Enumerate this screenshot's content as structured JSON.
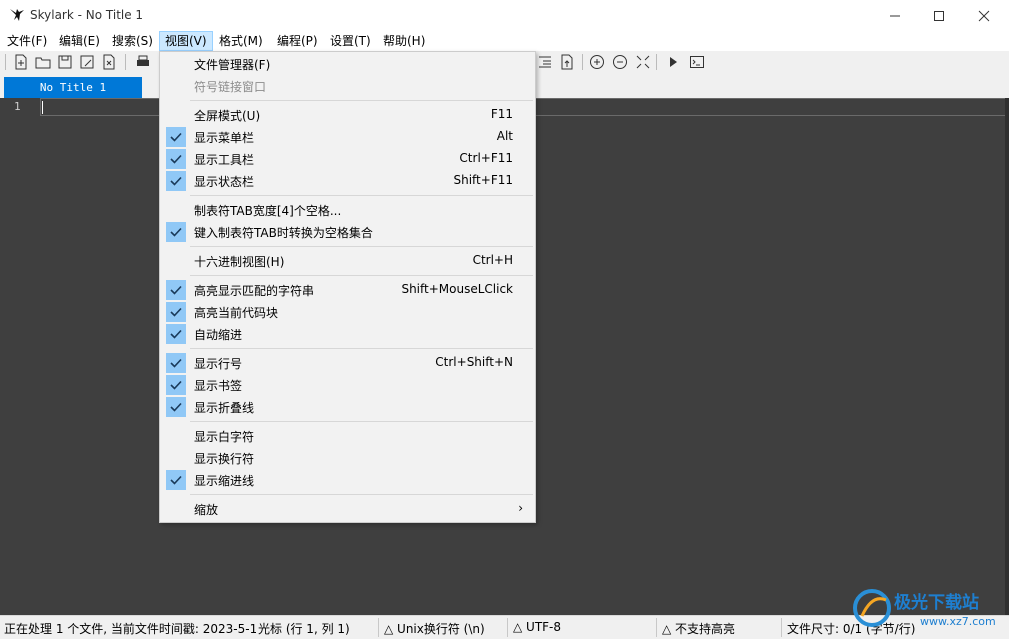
{
  "window": {
    "title": "Skylark - No Title 1"
  },
  "menubar": {
    "items": [
      {
        "label": "文件(F)"
      },
      {
        "label": "编辑(E)"
      },
      {
        "label": "搜索(S)"
      },
      {
        "label": "视图(V)"
      },
      {
        "label": "格式(M)"
      },
      {
        "label": "编程(P)"
      },
      {
        "label": "设置(T)"
      },
      {
        "label": "帮助(H)"
      }
    ],
    "active_index": 3
  },
  "tabs": [
    {
      "label": "No Title 1",
      "active": true
    }
  ],
  "editor": {
    "line_numbers": [
      "1"
    ]
  },
  "view_menu": {
    "items": [
      {
        "label": "文件管理器(F)",
        "shortcut": "",
        "checked": false,
        "disabled": false
      },
      {
        "label": "符号链接窗口",
        "shortcut": "",
        "checked": false,
        "disabled": true
      },
      {
        "label": "全屏模式(U)",
        "shortcut": "F11",
        "checked": false,
        "disabled": false
      },
      {
        "label": "显示菜单栏",
        "shortcut": "Alt",
        "checked": true,
        "disabled": false
      },
      {
        "label": "显示工具栏",
        "shortcut": "Ctrl+F11",
        "checked": true,
        "disabled": false
      },
      {
        "label": "显示状态栏",
        "shortcut": "Shift+F11",
        "checked": true,
        "disabled": false
      },
      {
        "label": "制表符TAB宽度[4]个空格...",
        "shortcut": "",
        "checked": false,
        "disabled": false
      },
      {
        "label": "键入制表符TAB时转换为空格集合",
        "shortcut": "",
        "checked": true,
        "disabled": false
      },
      {
        "label": "十六进制视图(H)",
        "shortcut": "Ctrl+H",
        "checked": false,
        "disabled": false
      },
      {
        "label": "高亮显示匹配的字符串",
        "shortcut": "Shift+MouseLClick",
        "checked": true,
        "disabled": false
      },
      {
        "label": "高亮当前代码块",
        "shortcut": "",
        "checked": true,
        "disabled": false
      },
      {
        "label": "自动缩进",
        "shortcut": "",
        "checked": true,
        "disabled": false
      },
      {
        "label": "显示行号",
        "shortcut": "Ctrl+Shift+N",
        "checked": true,
        "disabled": false
      },
      {
        "label": "显示书签",
        "shortcut": "",
        "checked": true,
        "disabled": false
      },
      {
        "label": "显示折叠线",
        "shortcut": "",
        "checked": true,
        "disabled": false
      },
      {
        "label": "显示白字符",
        "shortcut": "",
        "checked": false,
        "disabled": false
      },
      {
        "label": "显示换行符",
        "shortcut": "",
        "checked": false,
        "disabled": false
      },
      {
        "label": "显示缩进线",
        "shortcut": "",
        "checked": true,
        "disabled": false
      },
      {
        "label": "缩放",
        "shortcut": "",
        "checked": false,
        "disabled": false,
        "submenu": true
      }
    ]
  },
  "statusbar": {
    "processing": "正在处理 1 个文件, 当前文件时间戳: 2023-5-1",
    "cursor": "光标 (行 1, 列 1)",
    "eol": "△ Unix换行符 (\\n)",
    "encoding": "△ UTF-8",
    "highlight": "△ 不支持高亮",
    "filesize": "文件尺寸: 0/1 (字节/行)"
  },
  "watermark": {
    "text": "极光下载站",
    "url": "www.xz7.com"
  },
  "colors": {
    "accent": "#0078d7",
    "editor_bg": "#3f3f3f",
    "check_bg": "#90c8f6"
  }
}
